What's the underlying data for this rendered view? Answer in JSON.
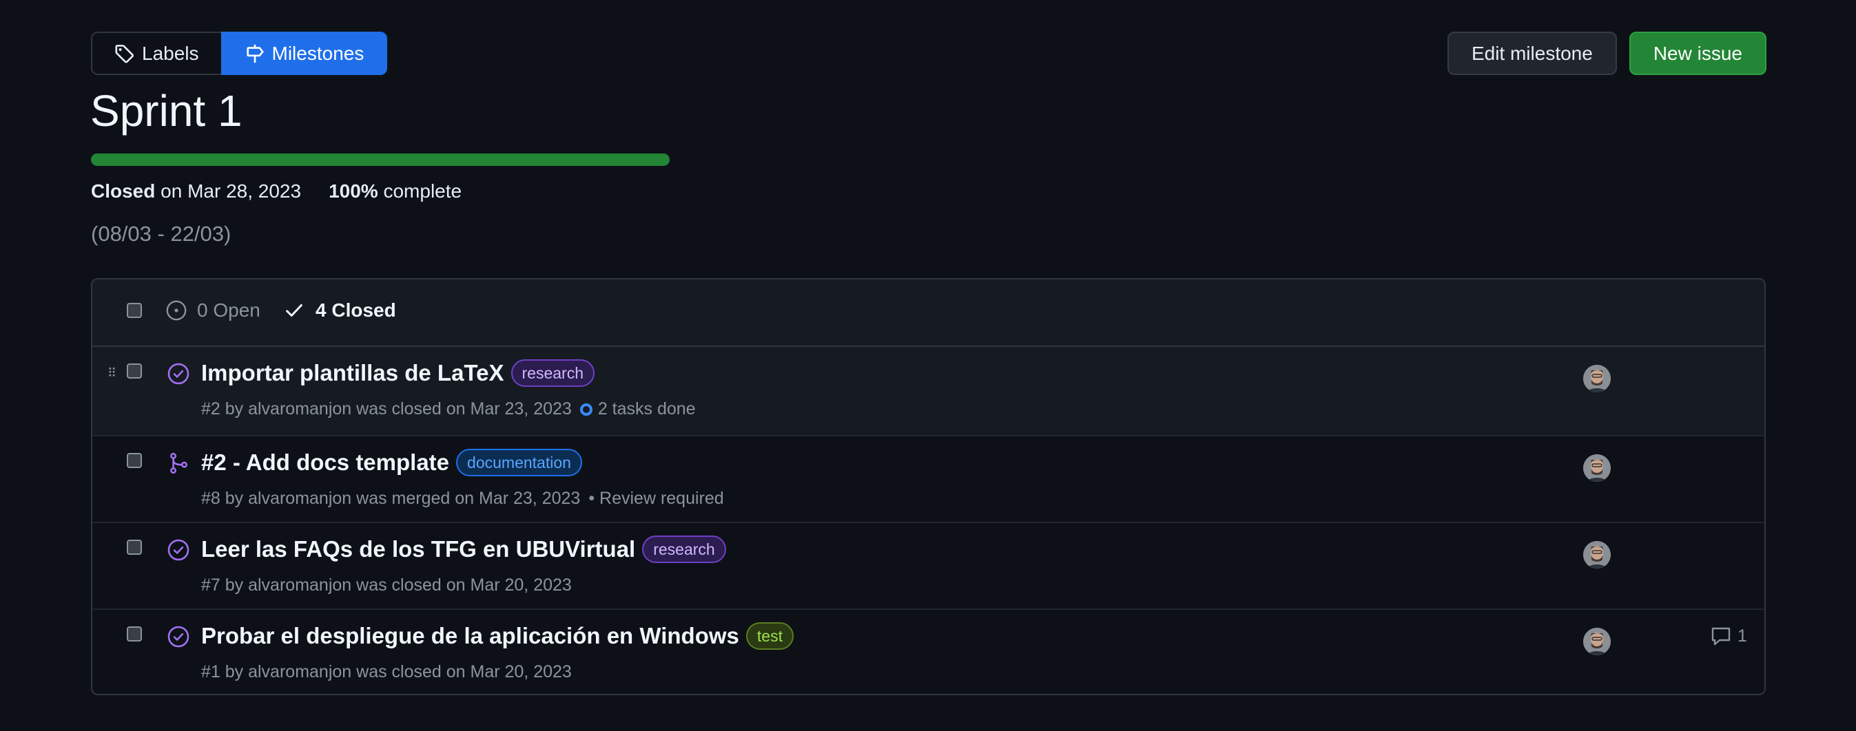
{
  "nav": {
    "labels": "Labels",
    "milestones": "Milestones"
  },
  "actions": {
    "edit": "Edit milestone",
    "new_issue": "New issue"
  },
  "milestone": {
    "title": "Sprint 1",
    "progress_percent": 100,
    "status_word": "Closed",
    "status_rest": "on Mar 28, 2023",
    "complete_pct": "100%",
    "complete_word": "complete",
    "description": "(08/03 - 22/03)"
  },
  "filters": {
    "open": "0 Open",
    "closed": "4 Closed"
  },
  "colors": {
    "accent_blue": "#1f6feb",
    "success_green": "#238636",
    "done_purple": "#a371f7"
  },
  "issues": [
    {
      "icon": "issue-closed-icon",
      "title": "Importar plantillas de LaTeX",
      "label": "research",
      "label_color": "#a371f7",
      "meta": "#2 by alvaromanjon was closed on Mar 23, 2023",
      "tasks": "2 tasks done"
    },
    {
      "icon": "pr-merged-icon",
      "title": "#2 - Add docs template",
      "label": "documentation",
      "label_color": "#1f6feb",
      "meta": "#8 by alvaromanjon was merged on Mar 23, 2023",
      "review": "• Review required"
    },
    {
      "icon": "issue-closed-icon",
      "title": "Leer las FAQs de los TFG en UBUVirtual",
      "label": "research",
      "label_color": "#a371f7",
      "meta": "#7 by alvaromanjon was closed on Mar 20, 2023"
    },
    {
      "icon": "issue-closed-icon",
      "title": "Probar el despliegue de la aplicación en Windows",
      "label": "test",
      "label_color": "#9be34e",
      "meta": "#1 by alvaromanjon was closed on Mar 20, 2023",
      "comments": "1"
    }
  ]
}
